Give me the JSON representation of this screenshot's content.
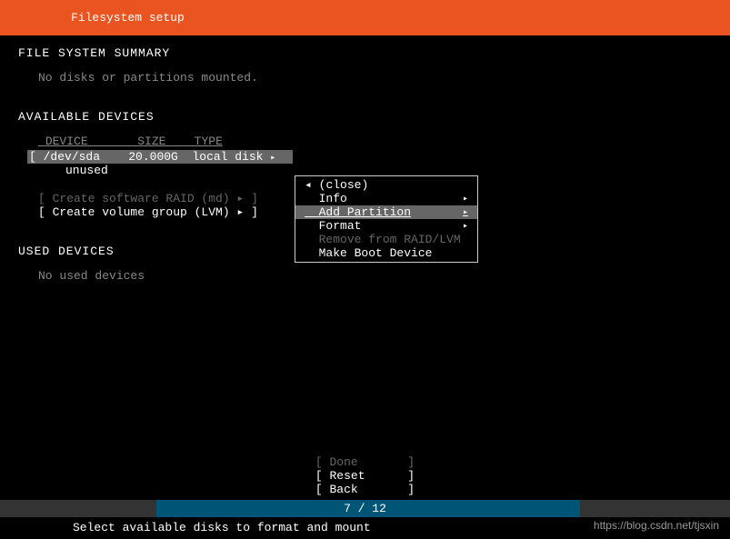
{
  "header": {
    "title": "Filesystem setup"
  },
  "summary": {
    "title": "FILE SYSTEM SUMMARY",
    "body": "No disks or partitions mounted."
  },
  "available": {
    "title": "AVAILABLE DEVICES",
    "columns": {
      "device": "DEVICE",
      "size": "SIZE",
      "type": "TYPE"
    },
    "device": {
      "name": "/dev/sda",
      "size": "20.000G",
      "type": "local disk",
      "status": "unused"
    },
    "raid_option": "[ Create software RAID (md) ▸ ]",
    "lvm_option": "[ Create volume group (LVM) ▸ ]"
  },
  "popup": {
    "close": "(close)",
    "info": "Info",
    "add_partition": "Add Partition",
    "format": "Format",
    "remove": "Remove from RAID/LVM",
    "make_boot": "Make Boot Device"
  },
  "used": {
    "title": "USED DEVICES",
    "body": "No used devices"
  },
  "buttons": {
    "done": "[ Done       ]",
    "reset": "[ Reset      ]",
    "back": "[ Back       ]"
  },
  "progress": {
    "text": "7 / 12"
  },
  "help": "Select available disks to format and mount",
  "watermark": "https://blog.csdn.net/tjsxin"
}
